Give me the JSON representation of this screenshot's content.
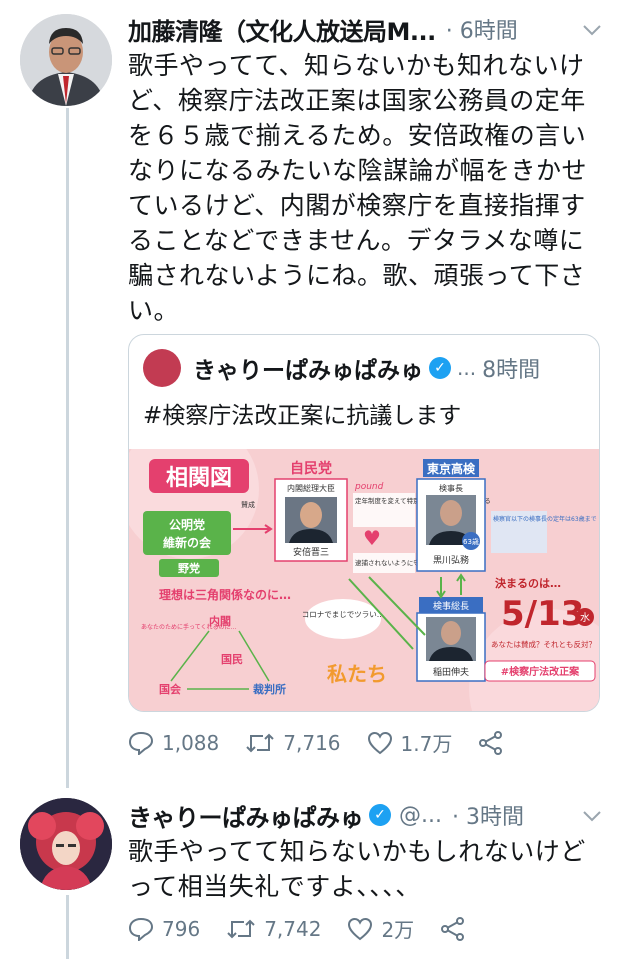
{
  "tweet1": {
    "name": "加藤清隆（文化人放送局M...",
    "time": "· 6時間",
    "body": "歌手やってて、知らないかも知れないけど、検察庁法改正案は国家公務員の定年を６５歳で揃えるため。安倍政権の言いなりになるみたいな陰謀論が幅をきかせているけど、内閣が検察庁を直接指揮することなどできません。デタラメな噂に騙されないようにね。歌、頑張って下さい。",
    "quote": {
      "name": "きゃりーぱみゅぱみゅ",
      "handle": "...",
      "time": "8時間",
      "body": "#検察庁法改正案に抗議します",
      "image": {
        "title": "相関図",
        "ldp": "自民党",
        "pm_role": "内閣総理大臣",
        "pm_name": "安倍晋三",
        "tokyo": "東京高検",
        "kenjicho": "検事長",
        "kurokawa": "黒川弘務",
        "badge63": "63歳",
        "sokencho": "検事総長",
        "inada": "稲田伸夫",
        "komei": "公明党",
        "ishin": "維新の会",
        "yato": "野党",
        "sansei": "賛成",
        "pound": "pound",
        "note1": "定年制度を変えて特別に検事総長にしてあげる",
        "note2": "逮捕されないように守ってあげる",
        "note3": "検察官以下の検事長の定年は63歳まで",
        "kettei": "決まるのは…",
        "date": "5/13",
        "weekday": "水",
        "anata": "あなたは賛成？それとも反対？",
        "hashtag": "#検察庁法改正案",
        "riso": "理想は三角関係なのに…",
        "naikaku": "内閣",
        "kokumin": "国民",
        "kokkai": "国会",
        "saibansho": "裁判所",
        "watashitachi": "私たち",
        "corona": "コロナでまじでツラい…",
        "teishutsu": "あなたのために手ってくれるのに…"
      }
    },
    "replies": "1,088",
    "retweets": "7,716",
    "likes": "1.7万"
  },
  "tweet2": {
    "name": "きゃりーぱみゅぱみゅ",
    "handle": "@...",
    "time": "· 3時間",
    "body": "歌手やってて知らないかもしれないけどって相当失礼ですよ、、、、",
    "replies": "796",
    "retweets": "7,742",
    "likes": "2万"
  },
  "colors": {
    "accent": "#1da1f2",
    "muted": "#657786",
    "border": "#ccd6dd",
    "pink": "#e4406e",
    "green": "#5ab34a"
  }
}
